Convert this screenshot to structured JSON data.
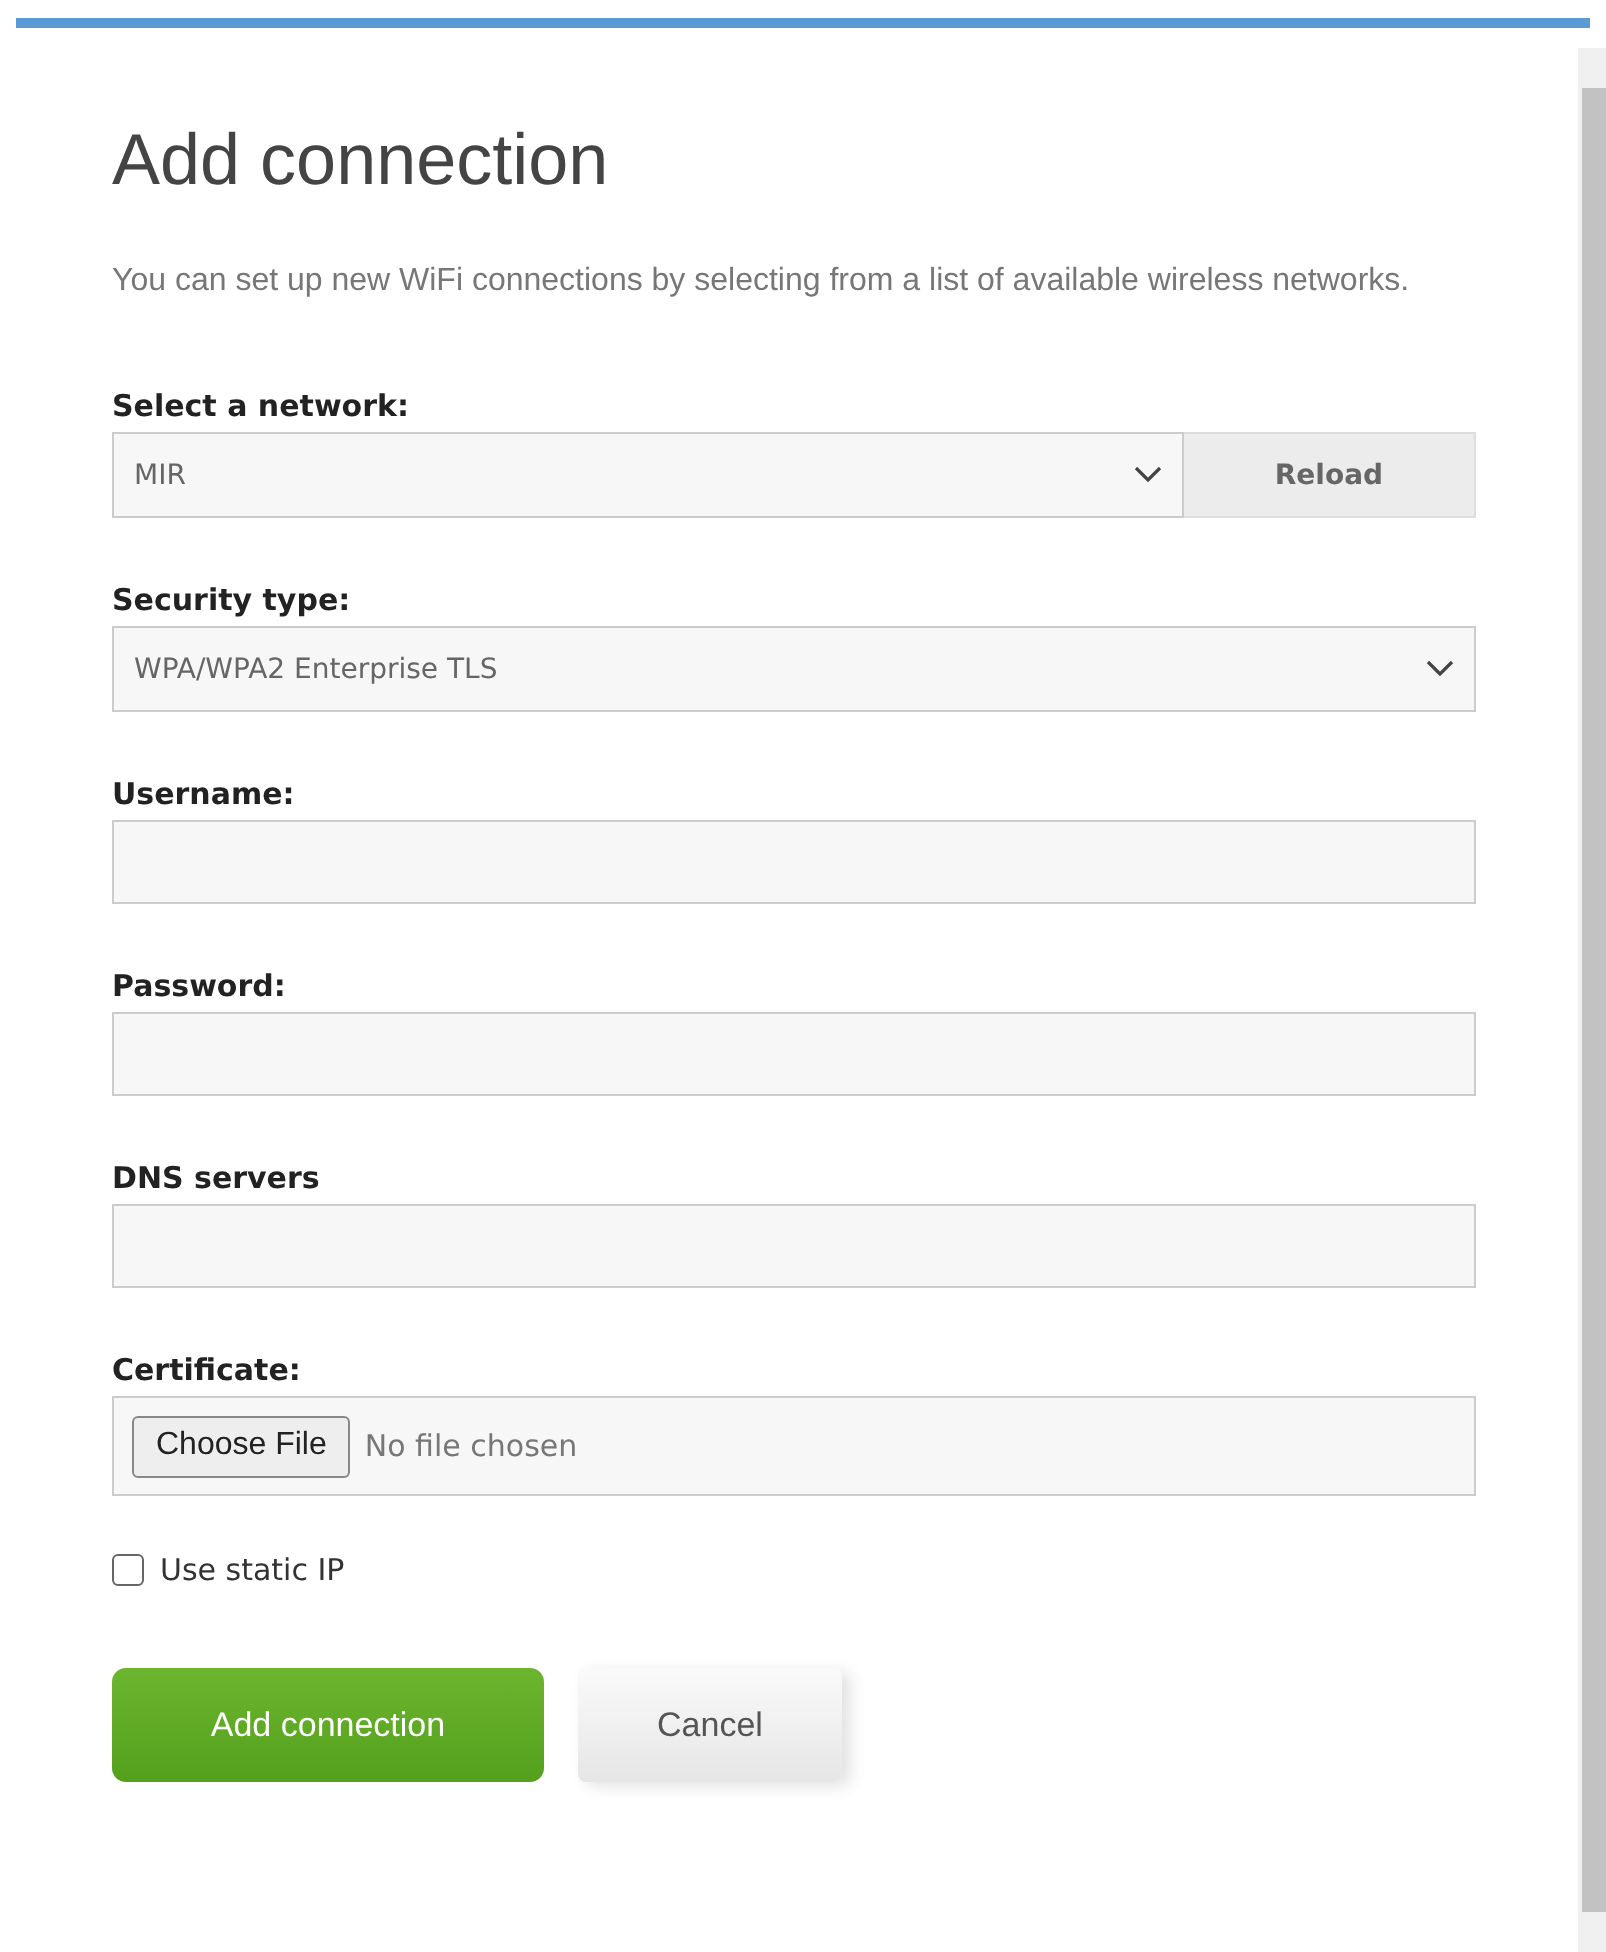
{
  "title": "Add connection",
  "description": "You can set up new WiFi connections by selecting from a list of available wireless networks.",
  "fields": [
    {
      "kind": "select",
      "label": "Select a network:",
      "value": "MIR",
      "button": "Reload"
    },
    {
      "kind": "select",
      "label": "Security type:",
      "value": "WPA/WPA2 Enterprise TLS"
    },
    {
      "kind": "text",
      "label": "Username:"
    },
    {
      "kind": "text",
      "label": "Password:"
    },
    {
      "kind": "text",
      "label": "DNS servers"
    },
    {
      "kind": "file",
      "label": "Certificate:",
      "button": "Choose File",
      "value": "No file chosen"
    }
  ],
  "static_ip": {
    "label": "Use static IP",
    "checked": false
  },
  "buttons": [
    {
      "kind": "primary",
      "label": "Add connection"
    },
    {
      "kind": "secondary",
      "label": "Cancel"
    }
  ]
}
